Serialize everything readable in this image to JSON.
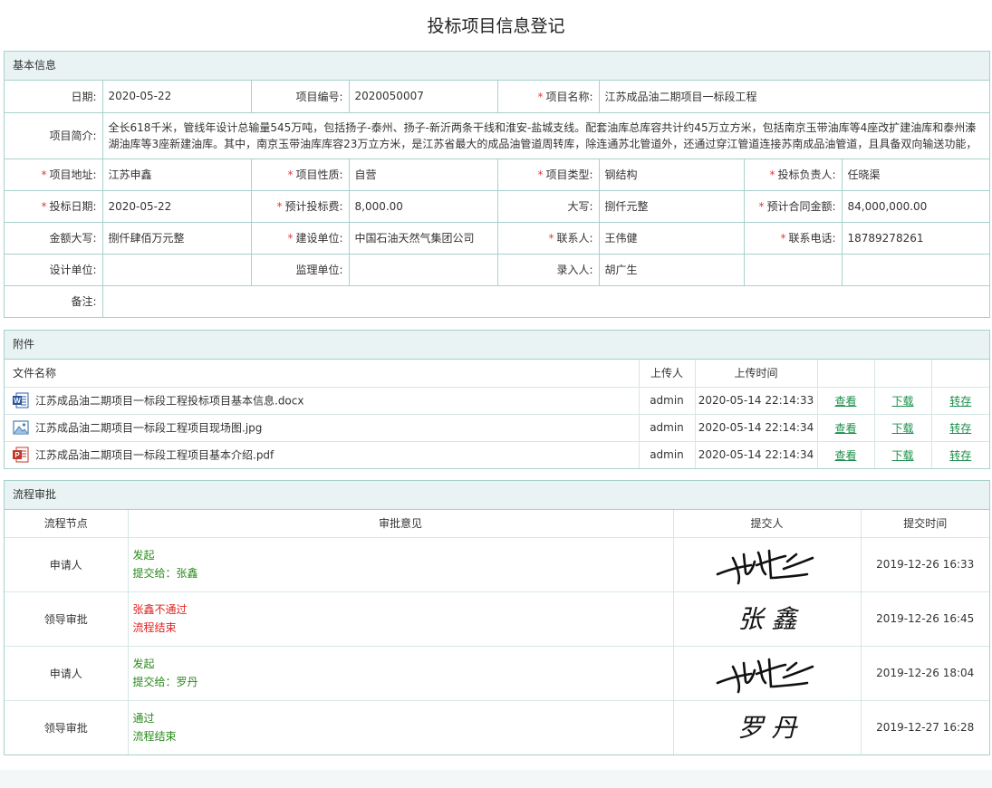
{
  "page": {
    "title": "投标项目信息登记"
  },
  "basic": {
    "section_title": "基本信息",
    "date_label": "日期:",
    "date": "2020-05-22",
    "project_no_label": "项目编号:",
    "project_no": "2020050007",
    "project_name_label": "项目名称:",
    "project_name": "江苏成品油二期项目一标段工程",
    "summary_label": "项目简介:",
    "summary": "全长618千米，管线年设计总输量545万吨，包括扬子-泰州、扬子-新沂两条干线和淮安-盐城支线。配套油库总库容共计约45万立方米，包括南京玉带油库等4座改扩建油库和泰州溱湖油库等3座新建油库。其中，南京玉带油库库容23万立方米，是江苏省最大的成品油管道周转库，除连通苏北管道外，还通过穿江管道连接苏南成品油管道，且具备双向输送功能，是",
    "address_label": "项目地址:",
    "address": "江苏申鑫",
    "nature_label": "项目性质:",
    "nature": "自营",
    "type_label": "项目类型:",
    "type": "钢结构",
    "owner_label": "投标负责人:",
    "owner": "任晓渠",
    "bid_date_label": "投标日期:",
    "bid_date": "2020-05-22",
    "bid_fee_label": "预计投标费:",
    "bid_fee": "8,000.00",
    "capital_label": "大写:",
    "capital": "捌仟元整",
    "contract_label": "预计合同金额:",
    "contract": "84,000,000.00",
    "amount_caps_label": "金额大写:",
    "amount_caps": "捌仟肆佰万元整",
    "builder_label": "建设单位:",
    "builder": "中国石油天然气集团公司",
    "contact_label": "联系人:",
    "contact": "王伟健",
    "phone_label": "联系电话:",
    "phone": "18789278261",
    "design_label": "设计单位:",
    "design": "",
    "supervise_label": "监理单位:",
    "supervise": "",
    "recorder_label": "录入人:",
    "recorder": "胡广生",
    "remark_label": "备注:",
    "remark": ""
  },
  "attachments": {
    "section_title": "附件",
    "headers": {
      "name": "文件名称",
      "uploader": "上传人",
      "time": "上传时间"
    },
    "files": [
      {
        "icon": "word-doc-icon",
        "name": "江苏成品油二期项目一标段工程投标项目基本信息.docx",
        "uploader": "admin",
        "time": "2020-05-14 22:14:33",
        "view": "查看",
        "download": "下载",
        "save": "转存"
      },
      {
        "icon": "image-file-icon",
        "name": "江苏成品油二期项目一标段工程项目现场图.jpg",
        "uploader": "admin",
        "time": "2020-05-14 22:14:34",
        "view": "查看",
        "download": "下载",
        "save": "转存"
      },
      {
        "icon": "pdf-file-icon",
        "name": "江苏成品油二期项目一标段工程项目基本介绍.pdf",
        "uploader": "admin",
        "time": "2020-05-14 22:14:34",
        "view": "查看",
        "download": "下载",
        "save": "转存"
      }
    ]
  },
  "workflow": {
    "section_title": "流程审批",
    "headers": {
      "node": "流程节点",
      "opinion": "审批意见",
      "submitter": "提交人",
      "time": "提交时间"
    },
    "rows": [
      {
        "node": "申请人",
        "line1": "发起",
        "line2": "提交给：张鑫",
        "status_color": "#2a8a1c",
        "time": "2019-12-26 16:33"
      },
      {
        "node": "领导审批",
        "line1": "张鑫不通过",
        "line2": "流程结束",
        "status_color": "#e21f1f",
        "time": "2019-12-26 16:45"
      },
      {
        "node": "申请人",
        "line1": "发起",
        "line2": "提交给：罗丹",
        "status_color": "#2a8a1c",
        "time": "2019-12-26 18:04"
      },
      {
        "node": "领导审批",
        "line1": "通过",
        "line2": "流程结束",
        "status_color": "#2a8a1c",
        "time": "2019-12-27 16:28"
      }
    ]
  },
  "colors": {
    "border": "#a8d1cc",
    "header_bg": "#e9f3f3",
    "link": "#1b8f4a",
    "required": "#e23b3b"
  }
}
